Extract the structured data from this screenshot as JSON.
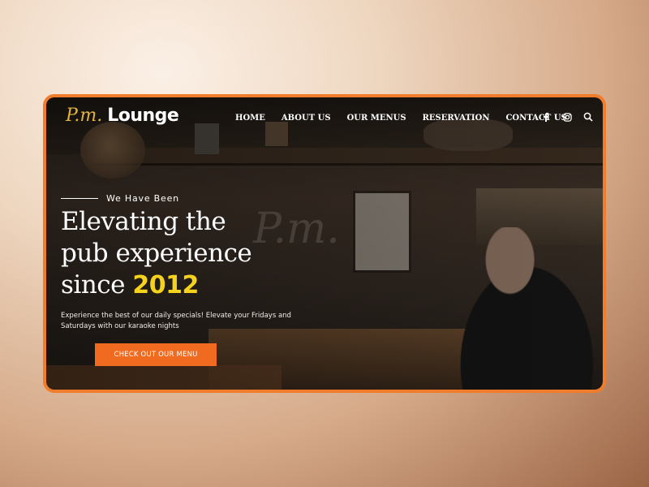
{
  "logo": {
    "script": "P.m.",
    "text": "Lounge"
  },
  "nav": {
    "items": [
      "HOME",
      "ABOUT US",
      "OUR MENUS",
      "RESERVATION",
      "CONTACT US"
    ]
  },
  "header_icons": [
    "facebook-icon",
    "instagram-icon",
    "search-icon"
  ],
  "hero": {
    "tagline": "We Have Been",
    "headline_line1": "Elevating the",
    "headline_line2": "pub experience",
    "headline_line3": "since",
    "year": "2012",
    "description": "Experience the best of our daily specials! Elevate your Fridays and Saturdays with our karaoke nights",
    "cta_label": "CHECK OUT OUR MENU"
  },
  "colors": {
    "accent_orange": "#f17c2b",
    "year_yellow": "#f5d21c",
    "logo_gold": "#e2b43c"
  }
}
